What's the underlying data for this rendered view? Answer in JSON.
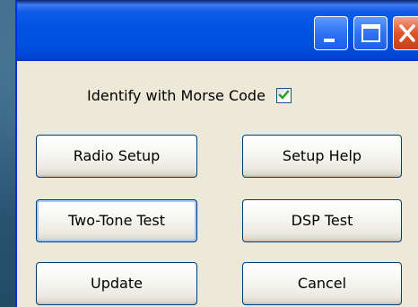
{
  "window": {
    "title_buttons": {
      "minimize_icon": "minimize-icon",
      "maximize_icon": "maximize-icon",
      "close_icon": "close-icon"
    },
    "accent_color": "#0054e3",
    "close_color": "#e0532a"
  },
  "options": {
    "morse_label": "Identify with Morse Code",
    "morse_checked": true,
    "check_icon": "checkmark-icon"
  },
  "buttons": {
    "radio_setup": "Radio Setup",
    "setup_help": "Setup Help",
    "two_tone_test": "Two-Tone Test",
    "dsp_test": "DSP Test",
    "update": "Update",
    "cancel": "Cancel"
  }
}
